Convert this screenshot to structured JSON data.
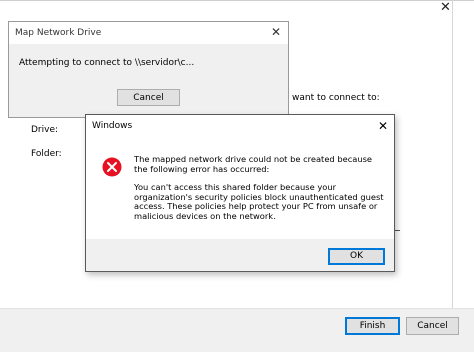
{
  "wizard": {
    "prompt": "want to connect to:",
    "drive_label": "Drive:",
    "folder_label": "Folder:",
    "finish_label": "Finish",
    "cancel_label": "Cancel"
  },
  "progress_dialog": {
    "title": "Map Network Drive",
    "message": "Attempting to connect to \\\\servidor\\c...",
    "cancel_label": "Cancel"
  },
  "error_dialog": {
    "title": "Windows",
    "message_1": "The mapped network drive could not be created because the following error has occurred:",
    "message_2": "You can't access this shared folder because your organization's security policies block unauthenticated guest access. These policies help protect your PC from unsafe or malicious devices on the network.",
    "ok_label": "OK",
    "icon": "error-icon"
  },
  "colors": {
    "accent": "#0078d7",
    "error_red": "#e81123"
  }
}
